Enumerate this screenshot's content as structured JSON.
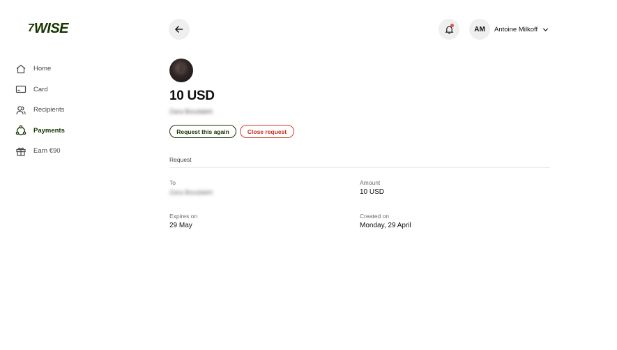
{
  "brand": {
    "logo_mark": "7",
    "logo_text": "WISE"
  },
  "sidebar": {
    "items": [
      {
        "label": "Home",
        "icon": "home-icon",
        "active": false
      },
      {
        "label": "Card",
        "icon": "card-icon",
        "active": false
      },
      {
        "label": "Recipients",
        "icon": "recipients-icon",
        "active": false
      },
      {
        "label": "Payments",
        "icon": "payments-icon",
        "active": true
      },
      {
        "label": "Earn €90",
        "icon": "gift-icon",
        "active": false
      }
    ]
  },
  "header": {
    "account_initials": "AM",
    "account_name": "Antoine Milkoff"
  },
  "request": {
    "amount": "10 USD",
    "recipient_name_blurred": "Zara Boudaleh",
    "actions": {
      "again": "Request this again",
      "close": "Close request"
    },
    "section_title": "Request",
    "fields": {
      "to_label": "To",
      "to_value": "Zara Boudaleh",
      "amount_label": "Amount",
      "amount_value": "10 USD",
      "expires_label": "Expires on",
      "expires_value": "29 May",
      "created_label": "Created on",
      "created_value": "Monday, 29 April"
    }
  },
  "colors": {
    "brand_green": "#163300",
    "danger": "#c2301f",
    "notification": "#e8524a"
  }
}
